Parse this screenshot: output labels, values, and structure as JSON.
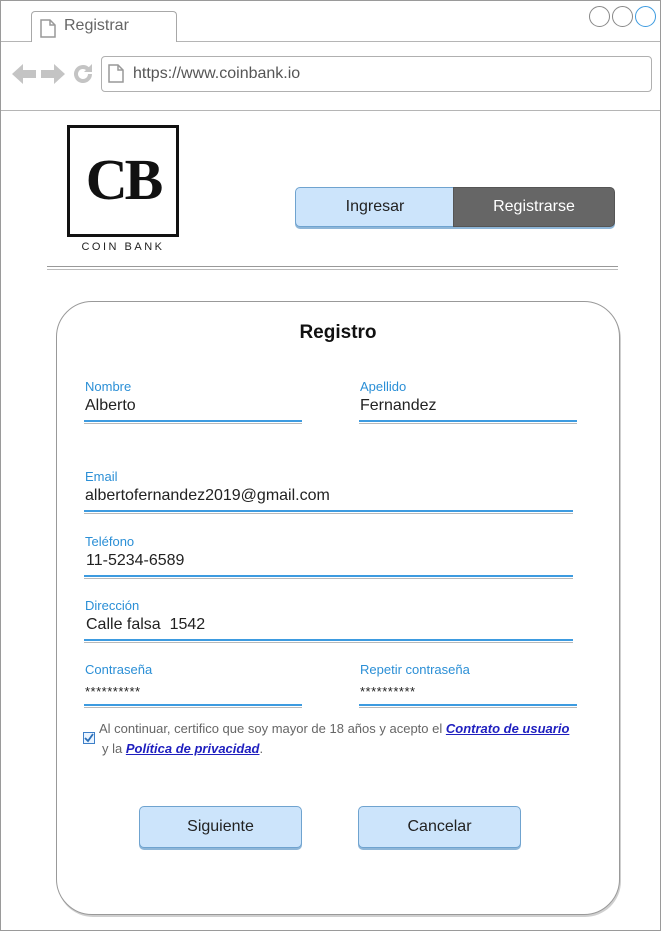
{
  "browser": {
    "tab_title": "Registrar",
    "url": "https://www.coinbank.io"
  },
  "header": {
    "logo_monogram": "CB",
    "logo_caption": "COIN BANK",
    "nav": {
      "login_label": "Ingresar",
      "register_label": "Registrarse",
      "active": "Registrarse"
    }
  },
  "form": {
    "title": "Registro",
    "nombre": {
      "label": "Nombre",
      "value": "Alberto"
    },
    "apellido": {
      "label": "Apellido",
      "value": "Fernandez"
    },
    "email": {
      "label": "Email",
      "value": "albertofernandez2019@gmail.com"
    },
    "telefono": {
      "label": "Teléfono",
      "value": "11-5234-6589"
    },
    "direccion": {
      "label": "Dirección",
      "value": "Calle falsa  1542"
    },
    "password": {
      "label": "Contraseña",
      "value": "**********"
    },
    "password_repeat": {
      "label": "Repetir contraseña",
      "value": "**********"
    },
    "terms": {
      "checked": true,
      "text_1": "Al continuar, certifico que soy mayor de 18 años y acepto el ",
      "link_contract": "Contrato de usuario",
      "text_2": "y la ",
      "link_privacy": "Política de privacidad",
      "text_end": "."
    },
    "next_label": "Siguiente",
    "cancel_label": "Cancelar"
  },
  "colors": {
    "accent": "#3d9be0",
    "button_fill": "#cce4fb",
    "active_nav": "#666666",
    "link": "#1f1fbf"
  }
}
